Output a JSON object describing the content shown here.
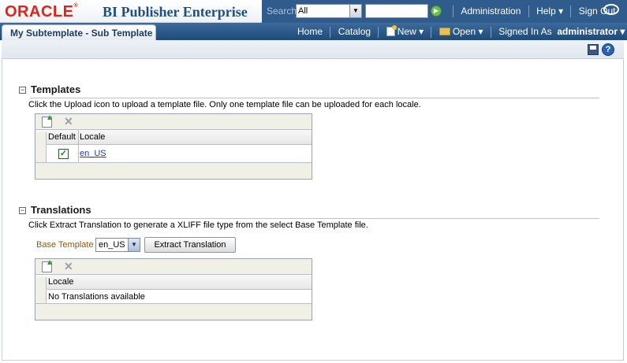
{
  "brand": {
    "logo_text": "ORACLE",
    "product": "BI Publisher Enterprise"
  },
  "search": {
    "label": "Search",
    "scope": "All",
    "query": ""
  },
  "top_links": [
    "Administration",
    "Help",
    "Sign Out"
  ],
  "page_tab": "My Subtemplate - Sub Template",
  "nav": {
    "home": "Home",
    "catalog": "Catalog",
    "new": "New",
    "open": "Open",
    "signed_in_as": "Signed In As",
    "user": "administrator"
  },
  "templates": {
    "title": "Templates",
    "description": "Click the Upload icon to upload a template file. Only one template file can be uploaded for each locale.",
    "columns": [
      "Default",
      "Locale"
    ],
    "rows": [
      {
        "default": true,
        "locale": "en_US"
      }
    ]
  },
  "translations": {
    "title": "Translations",
    "description": "Click Extract Translation to generate a XLIFF file type from the select Base Template file.",
    "base_template_label": "Base Template",
    "base_template_value": "en_US",
    "extract_button": "Extract Translation",
    "columns": [
      "Locale"
    ],
    "empty_text": "No Translations available"
  },
  "colors": {
    "oracle_red": "#e0231b",
    "nav_blue": "#2f5c8c",
    "link": "#1a3fa8"
  }
}
